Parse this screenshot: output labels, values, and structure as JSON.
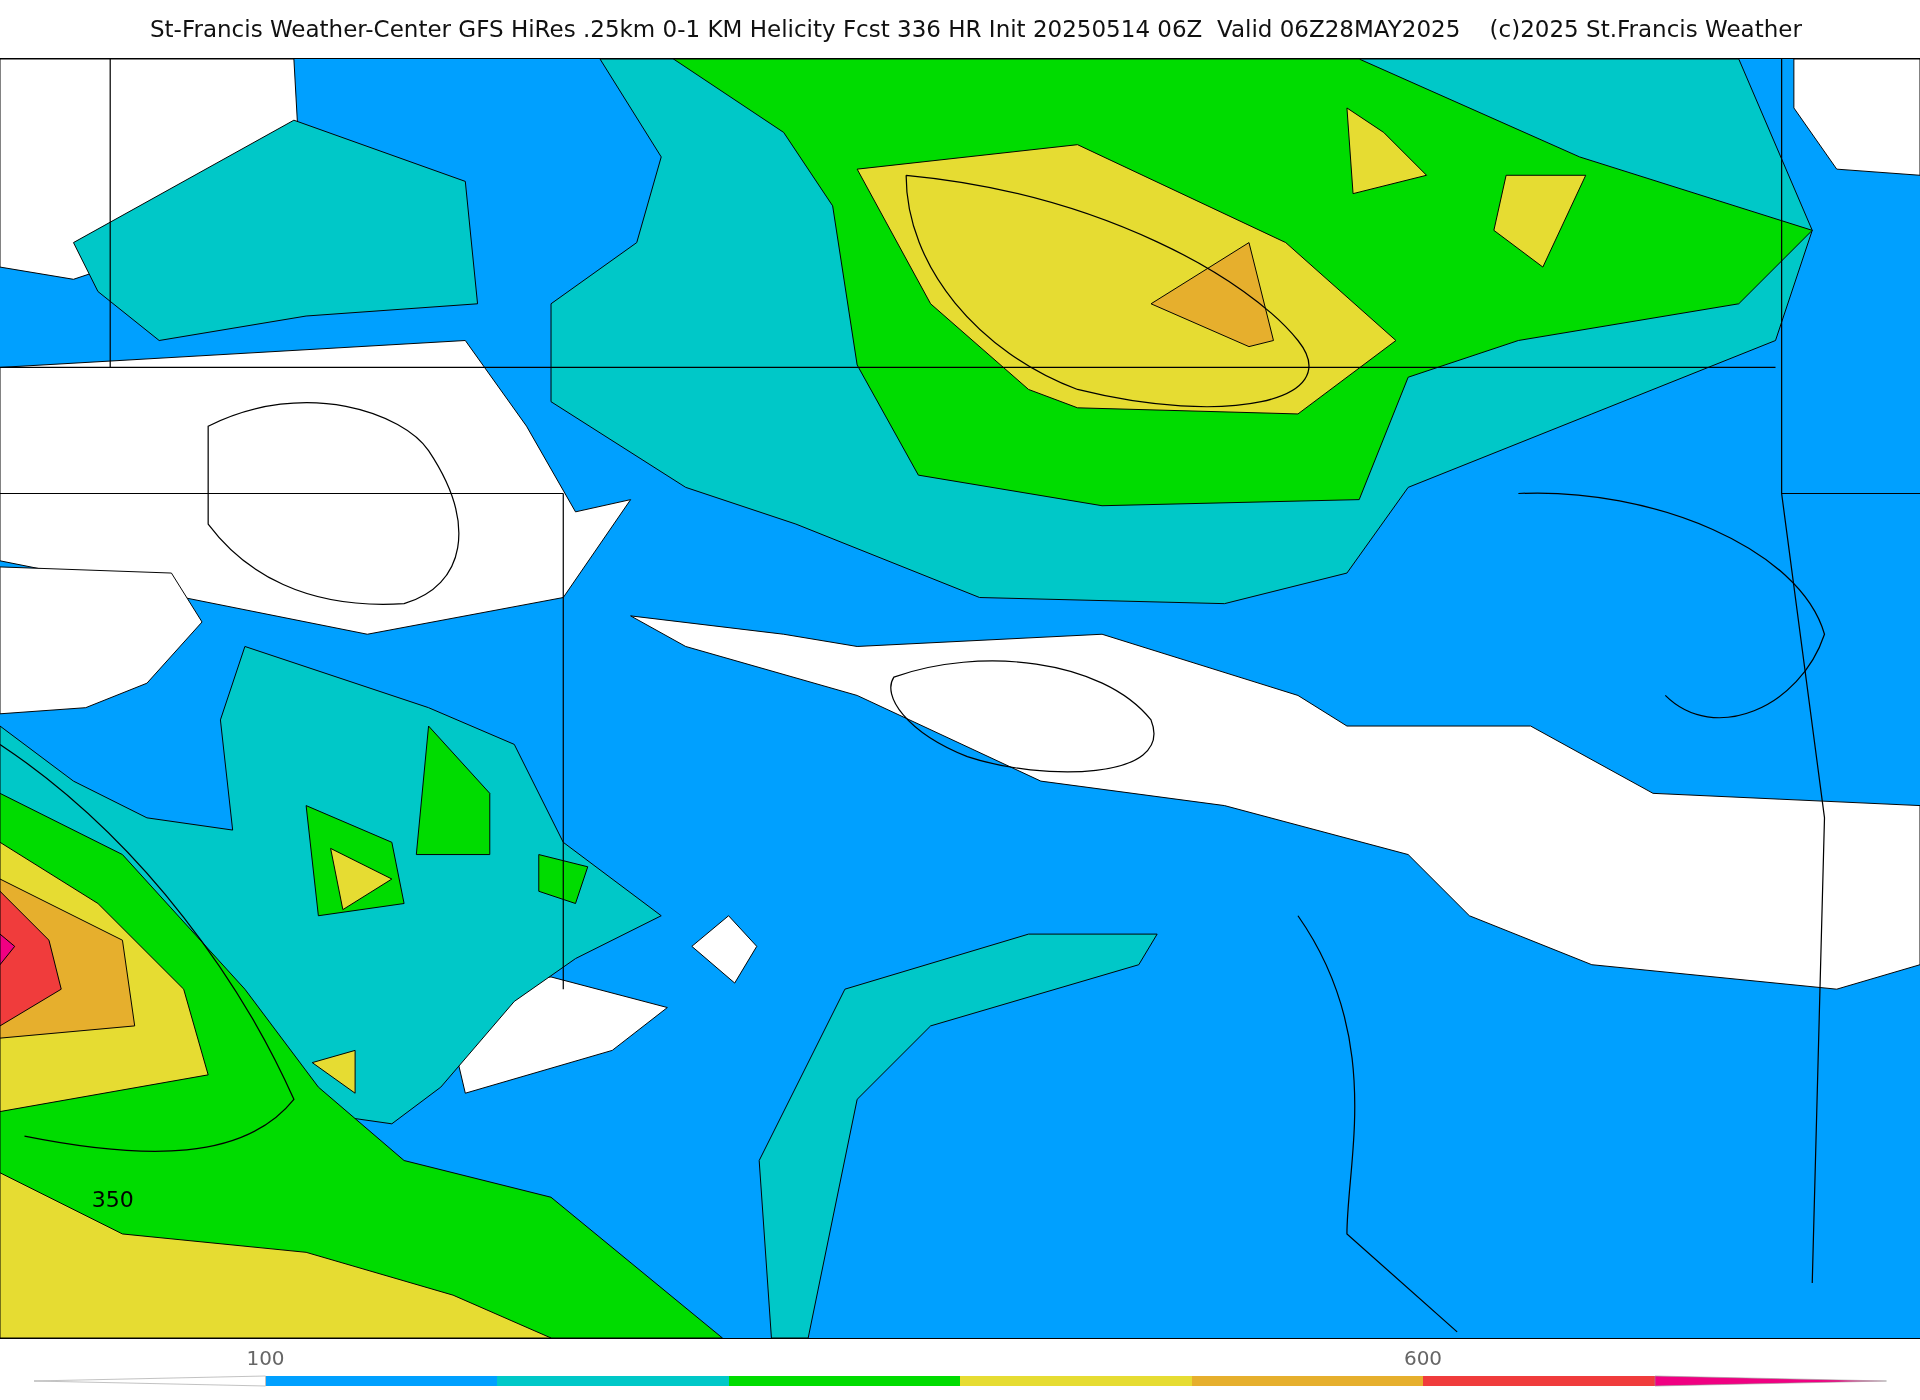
{
  "title": "St-Francis Weather-Center GFS HiRes .25km 0-1 KM Helicity Fcst 336 HR Init 20250514 06Z  Valid 06Z28MAY2025    (c)2025 St.Francis Weather",
  "map": {
    "contour_label": "350"
  },
  "colorbar": {
    "segments": [
      {
        "kind": "left_arrow",
        "color": "#ffffff"
      },
      {
        "kind": "block",
        "color": "#00a0ff",
        "label": "100"
      },
      {
        "kind": "block",
        "color": "#00c8c8"
      },
      {
        "kind": "block",
        "color": "#00dc00"
      },
      {
        "kind": "block",
        "color": "#e6dc32"
      },
      {
        "kind": "block",
        "color": "#e6af2d"
      },
      {
        "kind": "block",
        "color": "#f03c3c",
        "label": "600"
      },
      {
        "kind": "right_arrow",
        "color": "#f00082"
      }
    ]
  }
}
